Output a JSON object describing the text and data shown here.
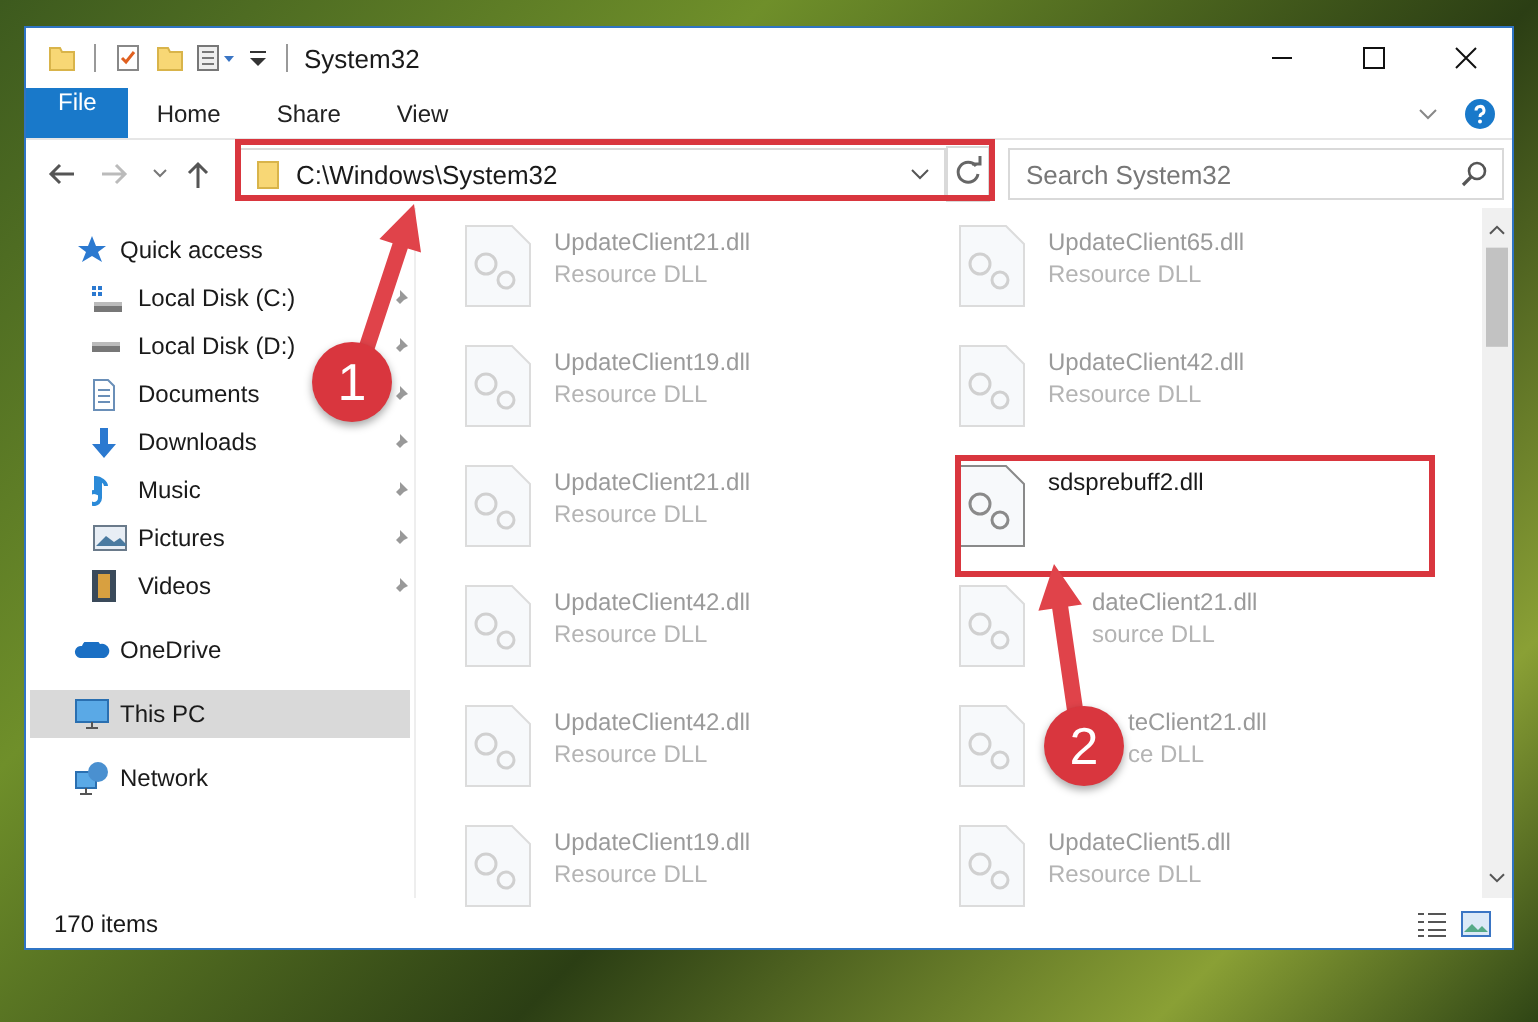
{
  "window": {
    "title": "System32"
  },
  "ribbon_tabs": [
    {
      "label": "File",
      "kind": "file"
    },
    {
      "label": "Home",
      "kind": "tab"
    },
    {
      "label": "Share",
      "kind": "tab"
    },
    {
      "label": "View",
      "kind": "tab"
    }
  ],
  "address_bar": {
    "path": "C:\\Windows\\System32"
  },
  "search": {
    "placeholder": "Search System32"
  },
  "sidebar": {
    "items": [
      {
        "label": "Quick access",
        "kind": "star",
        "selected": false,
        "children": [
          {
            "label": "Local Disk (C:)",
            "kind": "drive-c",
            "pinned": true,
            "selected": false
          },
          {
            "label": "Local Disk (D:)",
            "kind": "drive",
            "pinned": true,
            "selected": false
          },
          {
            "label": "Documents",
            "kind": "documents",
            "pinned": true,
            "selected": false
          },
          {
            "label": "Downloads",
            "kind": "downloads",
            "pinned": true,
            "selected": false
          },
          {
            "label": "Music",
            "kind": "music",
            "pinned": true,
            "selected": false
          },
          {
            "label": "Pictures",
            "kind": "pictures",
            "pinned": true,
            "selected": false
          },
          {
            "label": "Videos",
            "kind": "videos",
            "pinned": true,
            "selected": false
          }
        ]
      },
      {
        "label": "OneDrive",
        "kind": "cloud",
        "selected": false
      },
      {
        "label": "This PC",
        "kind": "computer",
        "selected": true
      },
      {
        "label": "Network",
        "kind": "network",
        "selected": false
      }
    ]
  },
  "files": [
    {
      "name": "UpdateClient21.dll",
      "type": "Resource DLL",
      "faded": true
    },
    {
      "name": "UpdateClient65.dll",
      "type": "Resource DLL",
      "faded": true
    },
    {
      "name": "UpdateClient19.dll",
      "type": "Resource DLL",
      "faded": true
    },
    {
      "name": "UpdateClient42.dll",
      "type": "Resource DLL",
      "faded": true
    },
    {
      "name": "UpdateClient21.dll",
      "type": "Resource DLL",
      "faded": true
    },
    {
      "name": "sdsprebuff2.dll",
      "faded": false
    },
    {
      "name": "UpdateClient42.dll",
      "type": "Resource DLL",
      "faded": true
    },
    {
      "name": "dateClient21.dll",
      "type": "source DLL",
      "faded": true
    },
    {
      "name": "UpdateClient42.dll",
      "type": "Resource DLL",
      "faded": true
    },
    {
      "name": "teClient21.dll",
      "type": "ce DLL",
      "faded": true
    },
    {
      "name": "UpdateClient19.dll",
      "type": "Resource DLL",
      "faded": true
    },
    {
      "name": "UpdateClient5.dll",
      "type": "Resource DLL",
      "faded": true
    }
  ],
  "status_bar": {
    "item_count": "170 items"
  },
  "annotations": [
    {
      "number": "1"
    },
    {
      "number": "2"
    }
  ]
}
